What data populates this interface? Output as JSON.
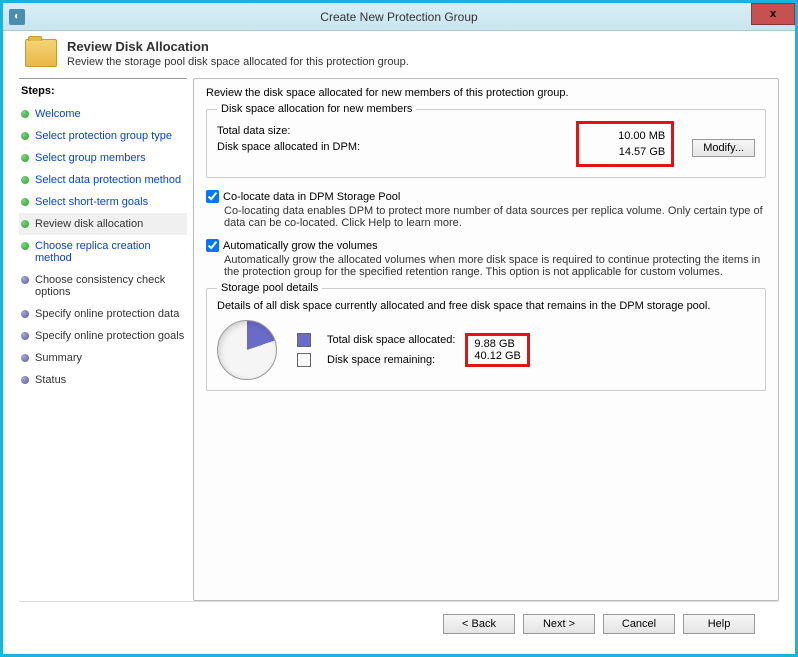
{
  "window": {
    "title": "Create New Protection Group",
    "close_label": "x"
  },
  "header": {
    "title": "Review Disk Allocation",
    "subtitle": "Review the storage pool disk space allocated for this protection group."
  },
  "sidebar": {
    "title": "Steps:",
    "steps": [
      {
        "label": "Welcome",
        "state": "done"
      },
      {
        "label": "Select protection group type",
        "state": "done"
      },
      {
        "label": "Select group members",
        "state": "done"
      },
      {
        "label": "Select data protection method",
        "state": "done"
      },
      {
        "label": "Select short-term goals",
        "state": "done"
      },
      {
        "label": "Review disk allocation",
        "state": "current"
      },
      {
        "label": "Choose replica creation method",
        "state": "done"
      },
      {
        "label": "Choose consistency check options",
        "state": "future"
      },
      {
        "label": "Specify online protection data",
        "state": "future"
      },
      {
        "label": "Specify online protection goals",
        "state": "future"
      },
      {
        "label": "Summary",
        "state": "future"
      },
      {
        "label": "Status",
        "state": "future"
      }
    ]
  },
  "main": {
    "intro": "Review the disk space allocated for new members of this protection group.",
    "allocation": {
      "legend": "Disk space allocation for new members",
      "total_label": "Total data size:",
      "total_value": "10.00 MB",
      "dpm_label": "Disk space allocated in DPM:",
      "dpm_value": "14.57 GB",
      "modify_label": "Modify..."
    },
    "colocate": {
      "checkbox_label": "Co-locate data in DPM Storage Pool",
      "desc": "Co-locating data enables DPM to protect more number of data sources per replica volume. Only certain type of data can be co-located. Click Help to learn more."
    },
    "autogrow": {
      "checkbox_label": "Automatically grow the volumes",
      "desc": "Automatically grow the allocated volumes when more disk space is required to continue protecting the items in the protection group for the specified retention range. This option is not applicable for custom volumes."
    },
    "pool": {
      "legend": "Storage pool details",
      "desc": "Details of all disk space currently allocated and free disk space that remains in the DPM storage pool.",
      "allocated_label": "Total disk space allocated:",
      "allocated_value": "9.88 GB",
      "remaining_label": "Disk space remaining:",
      "remaining_value": "40.12 GB"
    }
  },
  "footer": {
    "back": "< Back",
    "next": "Next >",
    "cancel": "Cancel",
    "help": "Help"
  }
}
